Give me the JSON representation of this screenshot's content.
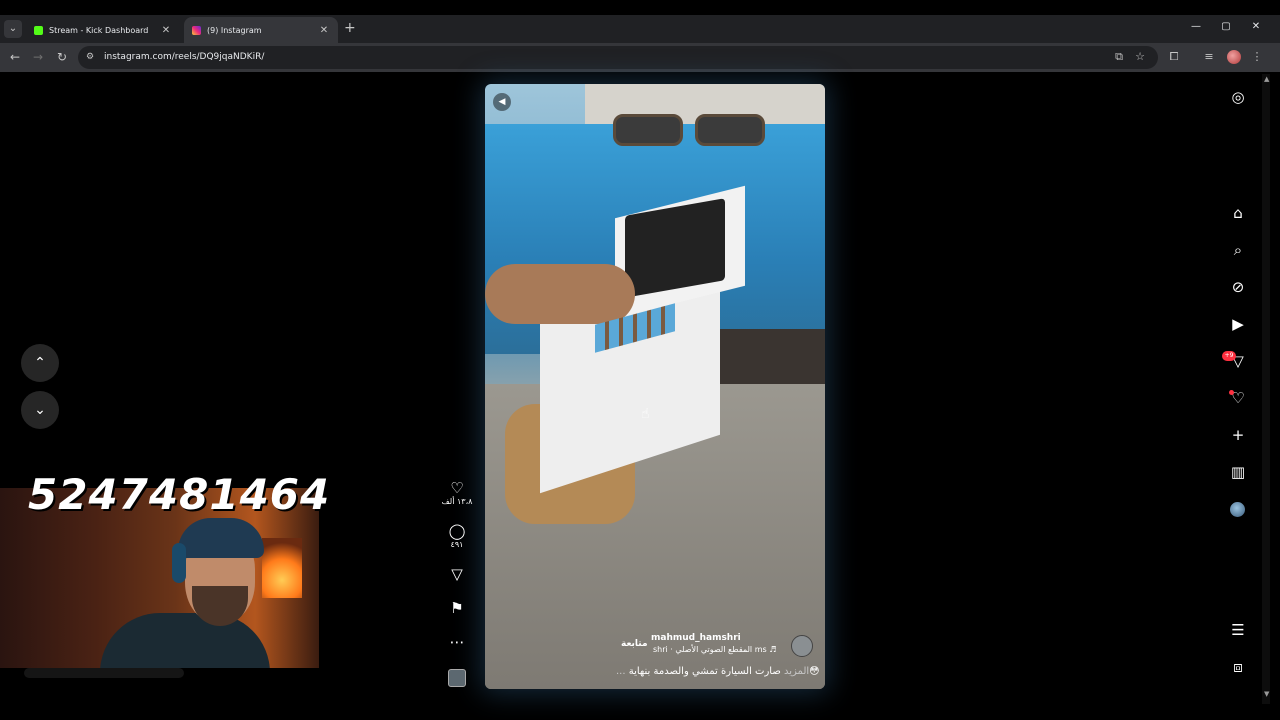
{
  "browser": {
    "tabs": [
      {
        "title": "Stream - Kick Dashboard",
        "favicon": "kick-icon"
      },
      {
        "title": "(9) Instagram",
        "favicon": "instagram-icon"
      }
    ],
    "url": "instagram.com/reels/DQ9jqaNDKiR/"
  },
  "reel": {
    "username": "mahmud_hamshri",
    "follow_label": "متابعة",
    "audio": "mahmud_hamshri · المقطع الصوتي الأصلي ♬",
    "audio_display": "shri · المقطع الصوتي الأصلي   ms ♬",
    "caption": "صارت السيارة تمشي والصدمة بنهاية😳",
    "caption_more": "... المزيد",
    "likes": "١٣،٨ ألف",
    "comments": "٤٩١"
  },
  "overlay": {
    "stream_number": "5247481464"
  },
  "rail": {
    "notification_badge": "+9"
  },
  "colors": {
    "badge": "#ff3040",
    "kick_green": "#53fc18",
    "reel_glow": "#3c78aa"
  }
}
